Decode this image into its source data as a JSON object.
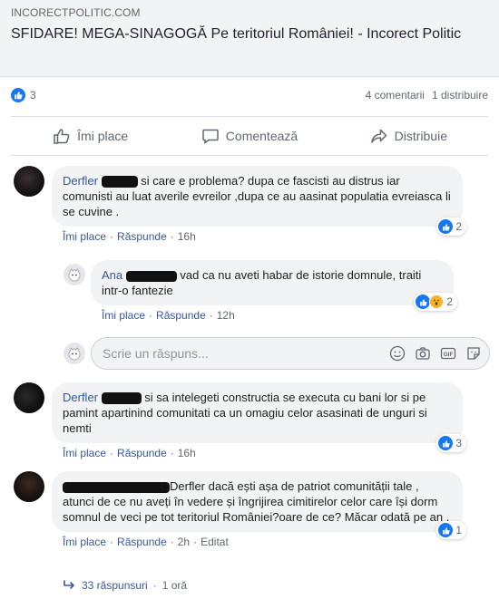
{
  "post": {
    "domain": "INCORECTPOLITIC.COM",
    "title": "SFIDARE! MEGA-SINAGOGĂ Pe teritoriul României! - Incorect Politic",
    "reaction_count": "3",
    "comment_count": "4 comentarii",
    "share_count": "1 distribuire",
    "like_label": "Îmi place",
    "comment_label": "Comentează",
    "share_label": "Distribuie"
  },
  "comments": [
    {
      "author": "Derfler",
      "text": " si care e problema? dupa ce fascisti au distrus iar comunisti au luat averile evreilor ,dupa ce au aasinat populatia evreiasca li se cuvine .",
      "like": "Îmi place",
      "reply": "Răspunde",
      "time": "16h",
      "reactions": "2",
      "reply_item": {
        "author": "Ana",
        "text": " vad ca nu aveti habar de istorie domnule, traiti intr-o fantezie",
        "like": "Îmi place",
        "reply": "Răspunde",
        "time": "12h",
        "reactions": "2"
      }
    },
    {
      "author": "Derfler",
      "text": " si sa intelegeti constructia se executa cu bani lor si pe pamint apartinind comunitati ca un omagiu celor asasinati de unguri si nemti",
      "like": "Îmi place",
      "reply": "Răspunde",
      "time": "16h",
      "reactions": "3"
    },
    {
      "author": "",
      "text": "Derfler dacă ești așa de patriot comunității tale , atunci de ce nu aveți în vedere și îngrijirea cimitirelor celor care își dorm somnul de veci pe tot teritoriul României?oare de ce? Măcar odată pe an .",
      "like": "Îmi place",
      "reply": "Răspunde",
      "time": "2h",
      "edited": "Editat",
      "reactions": "1"
    }
  ],
  "reply_box": {
    "placeholder": "Scrie un răspuns..."
  },
  "more_replies": {
    "label": "33 răspunsuri",
    "time": "1 oră"
  },
  "colors": {
    "accent": "#385898",
    "like_blue": "#1877f2",
    "bubble_bg": "#f2f3f5",
    "meta_gray": "#606770"
  }
}
